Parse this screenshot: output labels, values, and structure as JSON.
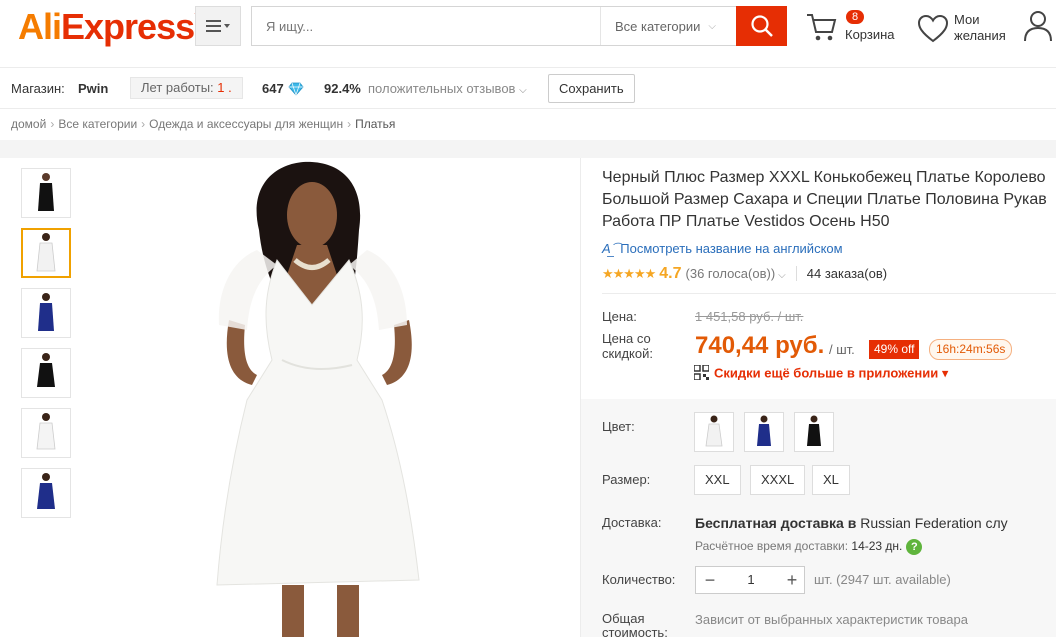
{
  "header": {
    "logo_ali": "Ali",
    "logo_express": "Express",
    "logo_tm": "™",
    "search_placeholder": "Я ищу...",
    "category": "Все категории",
    "cart_count": "8",
    "cart_label": "Корзина",
    "wishlist_label_1": "Мои",
    "wishlist_label_2": "желания"
  },
  "store": {
    "label": "Магазин:",
    "name": "Pwin",
    "years_label": "Лет работы:",
    "years_value": "1 .",
    "score": "647",
    "positive": "92.4%",
    "positive_label": "положительных отзывов",
    "save_label": "Сохранить"
  },
  "breadcrumbs": [
    "домой",
    "Все категории",
    "Одежда и аксессуары для женщин",
    "Платья"
  ],
  "product": {
    "title_line1": "Черный Плюс Размер XXXL Конькобежец Платье Королево",
    "title_line2": "Большой Размер Сахара и Специи Платье Половина Рукав",
    "title_line3": "Работа ПР Платье Vestidos Осень H50",
    "translate_label": "Посмотреть название на английском",
    "stars": "★★★★★",
    "rating": "4.7",
    "votes": "(36 голоса(ов))",
    "orders": "44 заказа(ов)",
    "price_label": "Цена:",
    "old_price": "1 451,58 руб. / шт.",
    "discount_label_1": "Цена со",
    "discount_label_2": "скидкой:",
    "new_price": "740,44 руб.",
    "per_unit": "/ шт.",
    "discount": "49% off",
    "timer": "16h:24m:56s",
    "app_promo": "Скидки ещё больше в приложении ▾",
    "color_label": "Цвет:",
    "size_label": "Размер:",
    "sizes": [
      "XXL",
      "XXXL",
      "XL"
    ],
    "delivery_label": "Доставка:",
    "delivery_text": "Бесплатная доставка в",
    "delivery_dest": "Russian Federation слу",
    "eta_label": "Расчётное время доставки:",
    "eta_days": "14-23 дн.",
    "help": "?",
    "qty_label": "Количество:",
    "qty_minus": "−",
    "qty_value": "1",
    "qty_plus": "+",
    "available": "шт. (2947 шт. available)",
    "total_label_1": "Общая",
    "total_label_2": "стоимость:",
    "total_text": "Зависит от выбранных характеристик товара"
  }
}
